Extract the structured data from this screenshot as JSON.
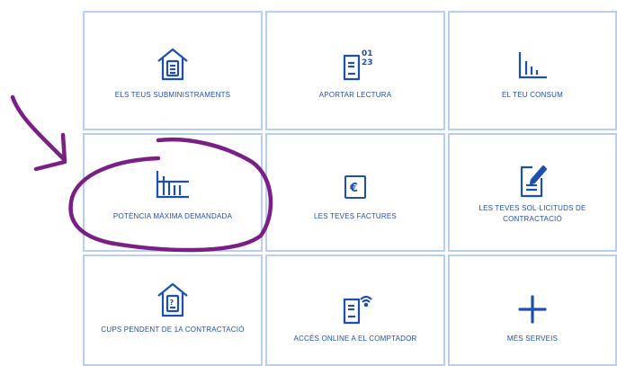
{
  "tiles": [
    {
      "label": "ELS TEUS SUBMINISTRAMENTS",
      "icon": "house-document-icon"
    },
    {
      "label": "APORTAR LECTURA",
      "icon": "meter-reading-icon"
    },
    {
      "label": "EL TEU CONSUM",
      "icon": "bar-chart-icon"
    },
    {
      "label": "POTÈNCIA MÀXIMA DEMANDADA",
      "icon": "power-chart-icon"
    },
    {
      "label": "LES TEVES FACTURES",
      "icon": "euro-invoice-icon"
    },
    {
      "label": "LES TEVES SOL·LICITUDS DE CONTRACTACIÓ",
      "icon": "document-edit-icon"
    },
    {
      "label": "CUPS PENDENT DE 1A CONTRACTACIÓ",
      "icon": "house-question-icon"
    },
    {
      "label": "ACCÉS ONLINE A EL COMPTADOR",
      "icon": "online-meter-icon"
    },
    {
      "label": "MÉS SERVEIS",
      "icon": "plus-icon"
    }
  ],
  "colors": {
    "accent": "#1f4fae",
    "tile_border": "#b9cff0",
    "annotation": "#7a1f86"
  }
}
